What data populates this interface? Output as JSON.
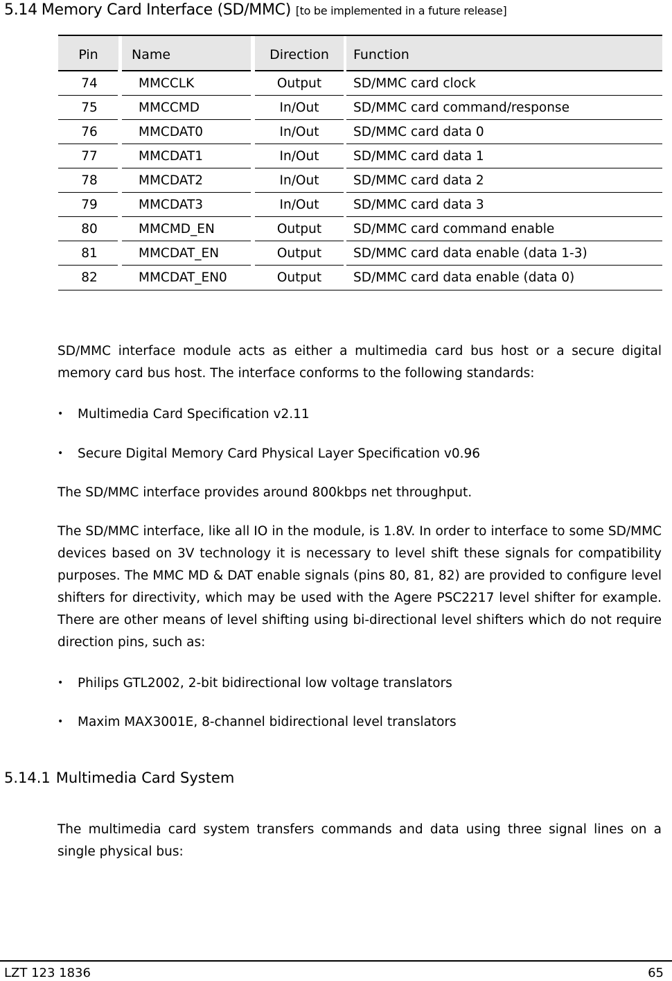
{
  "section": {
    "number": "5.14",
    "title": "Memory Card Interface (SD/MMC)",
    "note": "[to be implemented in a future release]"
  },
  "table": {
    "headers": [
      "Pin",
      "Name",
      "Direction",
      "Function"
    ],
    "rows": [
      [
        "74",
        "MMCCLK",
        "Output",
        "SD/MMC card clock"
      ],
      [
        "75",
        "MMCCMD",
        "In/Out",
        "SD/MMC card command/response"
      ],
      [
        "76",
        "MMCDAT0",
        "In/Out",
        "SD/MMC card data 0"
      ],
      [
        "77",
        "MMCDAT1",
        "In/Out",
        "SD/MMC card data 1"
      ],
      [
        "78",
        "MMCDAT2",
        "In/Out",
        "SD/MMC card data 2"
      ],
      [
        "79",
        "MMCDAT3",
        "In/Out",
        "SD/MMC card data 3"
      ],
      [
        "80",
        "MMCMD_EN",
        "Output",
        "SD/MMC card command enable"
      ],
      [
        "81",
        "MMCDAT_EN",
        "Output",
        "SD/MMC card data enable (data 1-3)"
      ],
      [
        "82",
        "MMCDAT_EN0",
        "Output",
        "SD/MMC card data enable (data 0)"
      ]
    ]
  },
  "body": {
    "intro": "SD/MMC interface module acts as either a multimedia card bus host or a secure digital memory card bus host.  The interface conforms to the following standards:",
    "standards": [
      "Multimedia Card Specification v2.11",
      "Secure Digital Memory Card Physical Layer Specification v0.96"
    ],
    "throughput": "The SD/MMC interface provides around 800kbps net throughput.",
    "level_shift": "The SD/MMC interface, like all IO in the module, is 1.8V.  In order to interface to some SD/MMC devices based on 3V technology it is necessary to level shift these signals for compatibility purposes.  The MMC MD & DAT enable signals (pins 80, 81, 82) are provided to configure level shifters for directivity, which may be used with the Agere PSC2217 level shifter for example.  There are other means of level shifting using bi-directional level shifters which do not require direction pins, such as:",
    "translators": [
      "Philips GTL2002, 2-bit bidirectional low voltage translators",
      "Maxim MAX3001E, 8-channel bidirectional level translators"
    ],
    "bullet_glyph": "•"
  },
  "subsection": {
    "number": "5.14.1",
    "title": "Multimedia Card System",
    "text": "The multimedia card system transfers commands and data using three signal lines on a single physical bus:"
  },
  "footer": {
    "doc_id": "LZT 123 1836",
    "page": "65"
  }
}
